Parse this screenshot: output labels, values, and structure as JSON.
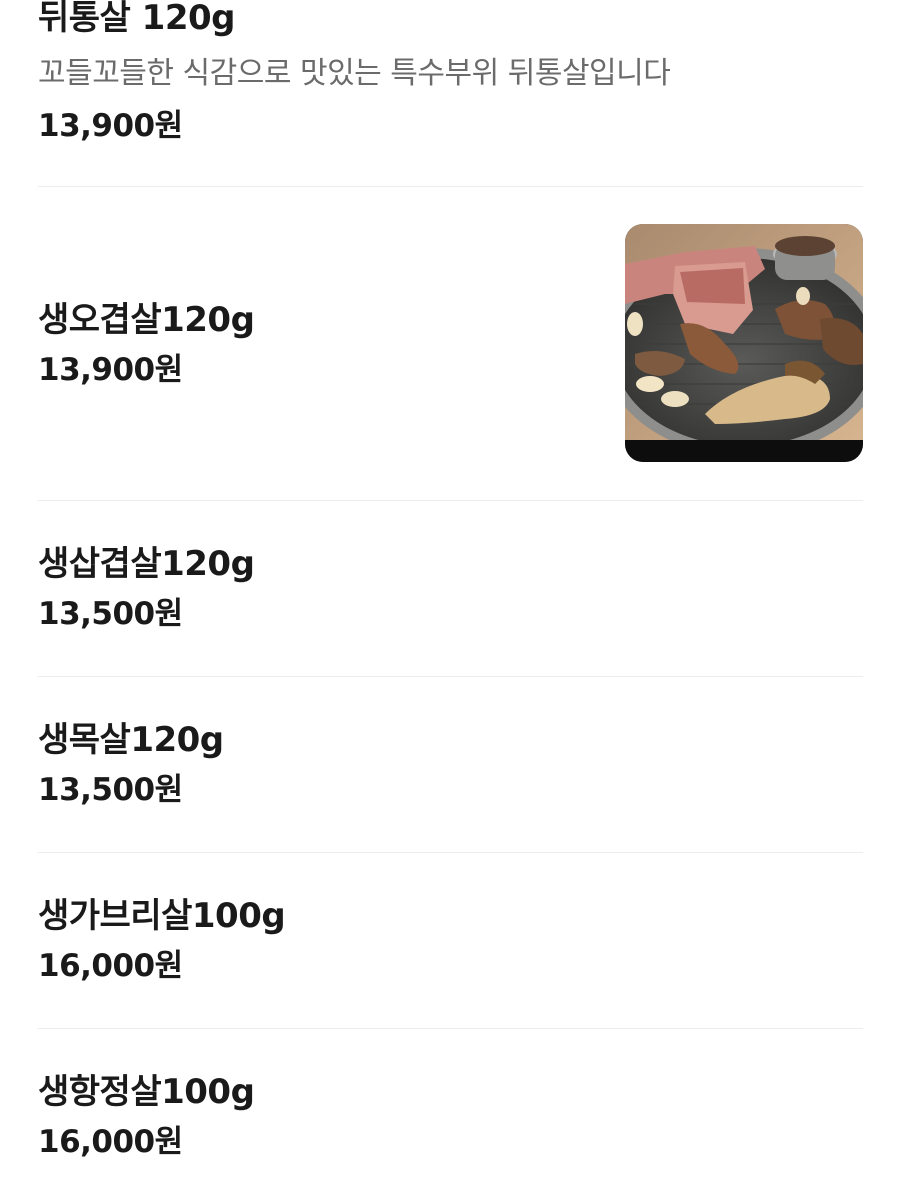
{
  "menu": {
    "items": [
      {
        "name": "뒤통살 120g",
        "description": "꼬들꼬들한 식감으로 맛있는 특수부위 뒤통살입니다",
        "price": "13,900원"
      },
      {
        "name": "생오겹살120g",
        "price": "13,900원",
        "image": "grilled-pork-on-grill-photo"
      },
      {
        "name": "생삽겹살120g",
        "price": "13,500원"
      },
      {
        "name": "생목살120g",
        "price": "13,500원"
      },
      {
        "name": "생가브리살100g",
        "price": "16,000원"
      },
      {
        "name": "생항정살100g",
        "price": "16,000원"
      }
    ]
  }
}
